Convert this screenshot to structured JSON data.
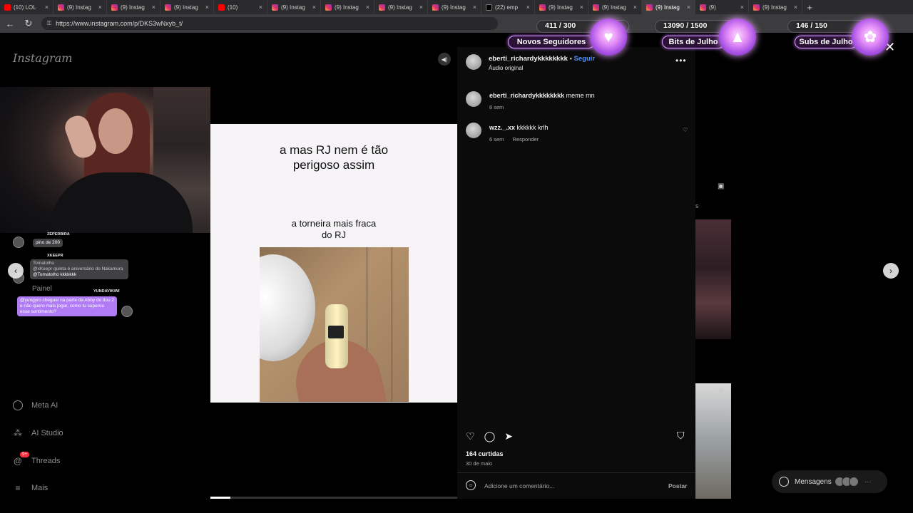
{
  "browser": {
    "tabs": [
      {
        "icon": "yt",
        "label": "(10) LOL"
      },
      {
        "icon": "ig",
        "label": "(9) Instag"
      },
      {
        "icon": "ig",
        "label": "(9) Instag"
      },
      {
        "icon": "ig",
        "label": "(9) Instag"
      },
      {
        "icon": "yt",
        "label": "(10)"
      },
      {
        "icon": "ig",
        "label": "(9) Instag"
      },
      {
        "icon": "ig",
        "label": "(9) Instag"
      },
      {
        "icon": "ig",
        "label": "(9) Instag"
      },
      {
        "icon": "ig",
        "label": "(9) Instag"
      },
      {
        "icon": "x",
        "label": "(22) emp"
      },
      {
        "icon": "ig",
        "label": "(9) Instag"
      },
      {
        "icon": "ig",
        "label": "(9) Instag"
      },
      {
        "icon": "ig",
        "label": "(9) Instag"
      },
      {
        "icon": "ig",
        "label": "(9)"
      },
      {
        "icon": "ig",
        "label": "(9) Instag"
      }
    ],
    "url": "https://www.instagram.com/p/DKS3wNxyb_t/"
  },
  "goals": [
    {
      "count": "411 / 300",
      "label": "Novos Seguidores",
      "icon": "heart-icon",
      "glyph": "♥"
    },
    {
      "count": "13090 / 1500",
      "label": "Bits de Julho",
      "icon": "gem-icon",
      "glyph": "▲"
    },
    {
      "count": "146 / 150",
      "label": "Subs de Julho",
      "icon": "flower-icon",
      "glyph": "✿"
    }
  ],
  "sidebar": {
    "logo": "Instagram",
    "partial_label": "Painel",
    "items": [
      {
        "label": "Meta AI",
        "icon": "meta-ai-icon"
      },
      {
        "label": "AI Studio",
        "icon": "ai-studio-icon"
      },
      {
        "label": "Threads",
        "icon": "threads-icon",
        "badge": "9+"
      },
      {
        "label": "Mais",
        "icon": "menu-icon"
      }
    ]
  },
  "chat": {
    "messages": [
      {
        "user": "ZEPERBIRA",
        "text": "pino de 200"
      },
      {
        "user": "XKEEPR",
        "reply_to": "Tomatolho",
        "reply_text": "@xKeepr quinta é aniversário do Nakamura",
        "text": "@Tomatolho kkkkkkk"
      },
      {
        "user": "YUNDAVIKIWI",
        "text": "@yungyro cheguei na parte da Abby do tlou 2 e não quero mais jogar, como tu superou esse sentimento?"
      }
    ]
  },
  "post": {
    "caption_top": "a mas RJ nem é tão\nperigoso assim",
    "caption_bottom": "a torneira mais fraca\ndo RJ",
    "progress": 0.08,
    "author": "eberti_richardykkkkkkkk",
    "separator": "•",
    "follow": "Seguir",
    "audio": "Áudio original",
    "comments": [
      {
        "user": "eberti_richardykkkkkkkk",
        "text": "meme mn",
        "time": "8 sem",
        "reply": ""
      },
      {
        "user": "wzz._.xx",
        "text": "kkkkkk krlh",
        "time": "6 sem",
        "reply": "Responder"
      }
    ],
    "likes": "164 curtidas",
    "date": "30 de maio",
    "comment_placeholder": "Adicione um comentário...",
    "post_button": "Postar"
  },
  "messages_pill": {
    "label": "Mensagens",
    "badge": "9+"
  }
}
